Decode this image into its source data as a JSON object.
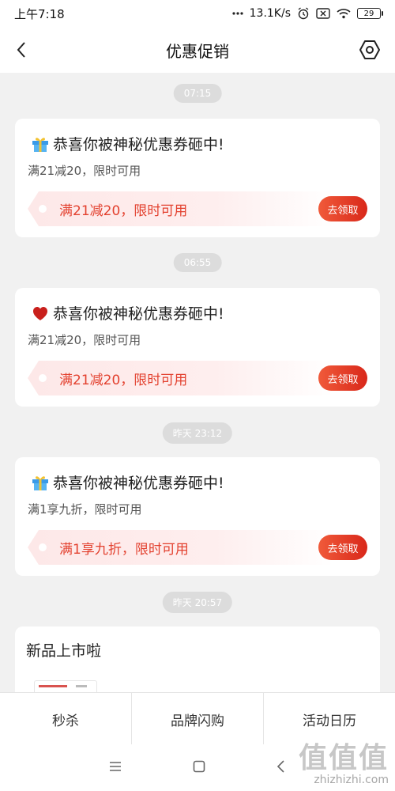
{
  "status_bar": {
    "time": "上午7:18",
    "speed": "13.1K/s",
    "battery": "29"
  },
  "nav": {
    "title": "优惠促销"
  },
  "messages": [
    {
      "time": "07:15",
      "icon": "gift-icon",
      "title": "恭喜你被神秘优惠券砸中!",
      "subtitle": "满21减20，限时可用",
      "coupon": "满21减20，限时可用",
      "button": "去领取"
    },
    {
      "time": "06:55",
      "icon": "heart-icon",
      "title": "恭喜你被神秘优惠券砸中!",
      "subtitle": "满21减20，限时可用",
      "coupon": "满21减20，限时可用",
      "button": "去领取"
    },
    {
      "time": "昨天 23:12",
      "icon": "gift-icon",
      "title": "恭喜你被神秘优惠券砸中!",
      "subtitle": "满1享九折，限时可用",
      "coupon": "满1享九折，限时可用",
      "button": "去领取"
    },
    {
      "time": "昨天 20:57",
      "title": "新品上市啦"
    }
  ],
  "tabs": [
    "秒杀",
    "品牌闪购",
    "活动日历"
  ],
  "watermark": {
    "glyphs": "值值值",
    "text": "zhizhizhi.com"
  },
  "colors": {
    "accent": "#e3412f",
    "button": "#e0321f",
    "background": "#f1f1f1"
  }
}
